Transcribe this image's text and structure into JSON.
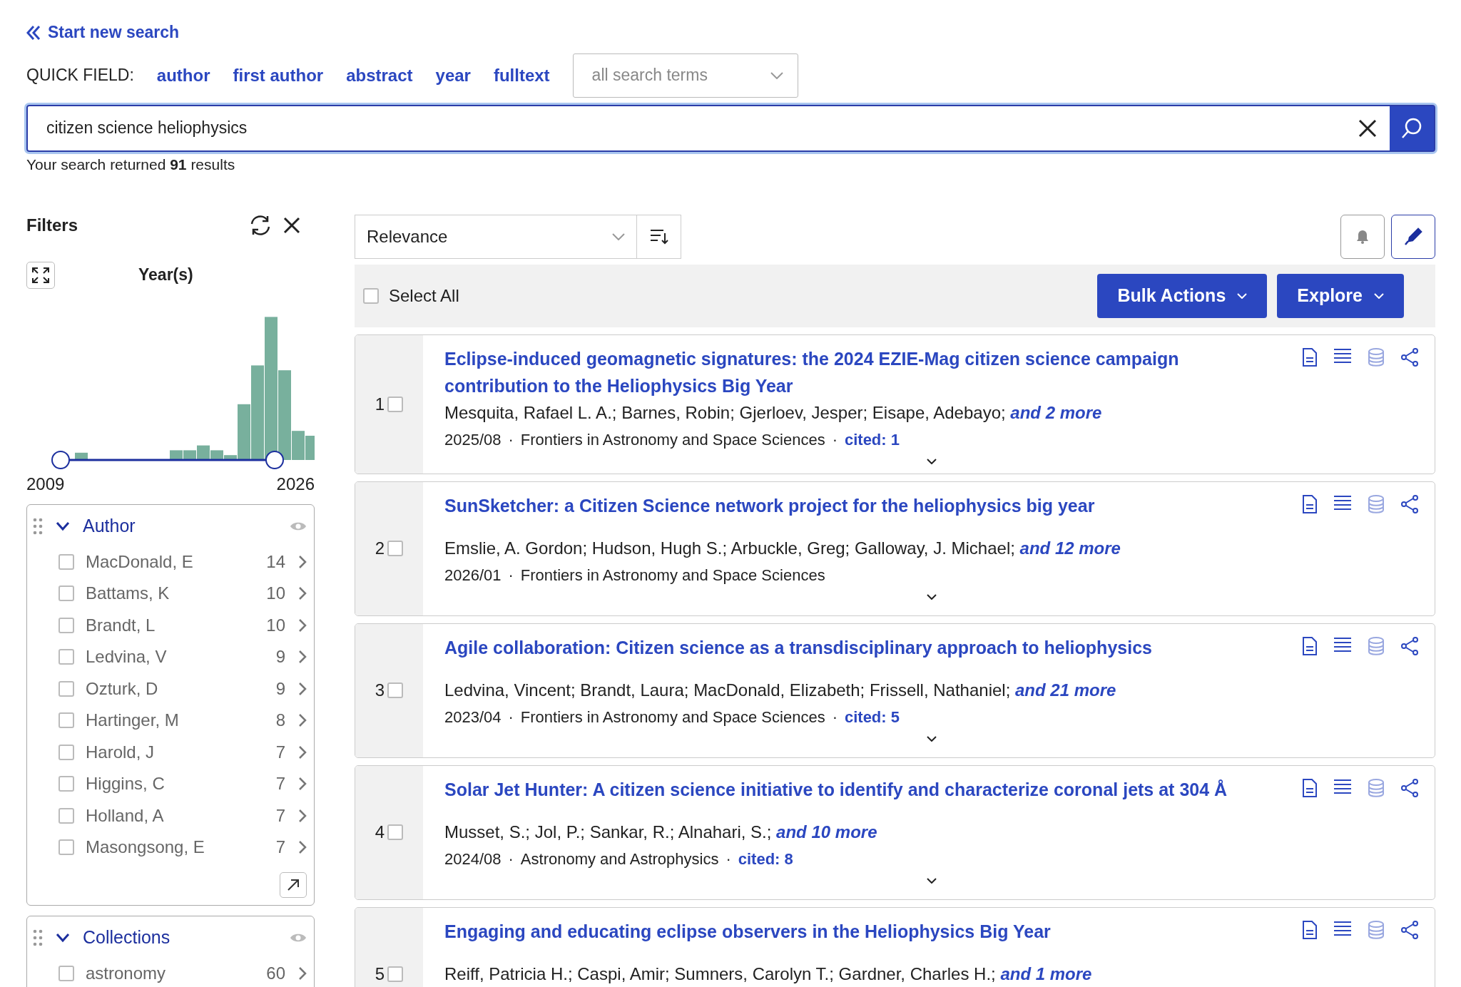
{
  "back_link": "Start new search",
  "quick_field": {
    "label": "QUICK FIELD:",
    "fields": [
      "author",
      "first author",
      "abstract",
      "year",
      "fulltext"
    ],
    "scope": {
      "value": "all search terms"
    }
  },
  "search": {
    "value": "citizen science heliophysics"
  },
  "summary": "Your search returned **91** results",
  "filters": {
    "title": "Filters",
    "year": {
      "title": "Year(s)",
      "min": "2009",
      "max": "2026"
    },
    "facets": [
      {
        "title": "Author",
        "expanded": true,
        "items": [
          {
            "label": "MacDonald, E",
            "count": "14",
            "checked": false
          },
          {
            "label": "Battams, K",
            "count": "10",
            "checked": false
          },
          {
            "label": "Brandt, L",
            "count": "10",
            "checked": false
          },
          {
            "label": "Ledvina, V",
            "count": "9",
            "checked": false
          },
          {
            "label": "Ozturk, D",
            "count": "9",
            "checked": false
          },
          {
            "label": "Hartinger, M",
            "count": "8",
            "checked": false
          },
          {
            "label": "Harold, J",
            "count": "7",
            "checked": false
          },
          {
            "label": "Higgins, C",
            "count": "7",
            "checked": false
          },
          {
            "label": "Holland, A",
            "count": "7",
            "checked": false
          },
          {
            "label": "Masongsong, E",
            "count": "7",
            "checked": false
          }
        ]
      },
      {
        "title": "Collections",
        "expanded": true,
        "items": [
          {
            "label": "astronomy",
            "count": "60",
            "checked": false
          }
        ]
      }
    ]
  },
  "sort": {
    "value": "Relevance"
  },
  "select_all": {
    "label": "Select All",
    "checked": false
  },
  "actions": [
    "Bulk Actions",
    "Explore"
  ],
  "meta_separator": "·",
  "results": [
    {
      "index": "1",
      "checked": false,
      "title": "Eclipse-induced geomagnetic signatures: the 2024 EZIE-Mag citizen science campaign contribution to the Heliophysics Big Year",
      "authors": "Mesquita, Rafael L. A.; Barnes, Robin; Gjerloev, Jesper; Eisape, Adebayo;",
      "more": "and 2 more",
      "date": "2025/08",
      "journal": "Frontiers in Astronomy and Space Sciences",
      "cited": "cited: 1"
    },
    {
      "index": "2",
      "checked": false,
      "title": "SunSketcher: a Citizen Science network project for the heliophysics big year",
      "authors": "Emslie, A. Gordon; Hudson, Hugh S.; Arbuckle, Greg; Galloway, J. Michael;",
      "more": "and 12 more",
      "date": "2026/01",
      "journal": "Frontiers in Astronomy and Space Sciences"
    },
    {
      "index": "3",
      "checked": false,
      "title": "Agile collaboration: Citizen science as a transdisciplinary approach to heliophysics",
      "authors": "Ledvina, Vincent; Brandt, Laura; MacDonald, Elizabeth; Frissell, Nathaniel;",
      "more": "and 21 more",
      "date": "2023/04",
      "journal": "Frontiers in Astronomy and Space Sciences",
      "cited": "cited: 5"
    },
    {
      "index": "4",
      "checked": false,
      "title": "Solar Jet Hunter: A citizen science initiative to identify and characterize coronal jets at 304 Å",
      "authors": "Musset, S.; Jol, P.; Sankar, R.; Alnahari, S.;",
      "more": "and 10 more",
      "date": "2024/08",
      "journal": "Astronomy and Astrophysics",
      "cited": "cited: 8"
    },
    {
      "index": "5",
      "checked": false,
      "title": "Engaging and educating eclipse observers in the Heliophysics Big Year",
      "authors": "Reiff, Patricia H.; Caspi, Amir; Sumners, Carolyn T.; Gardner, Charles H.;",
      "more": "and 1 more"
    }
  ]
}
